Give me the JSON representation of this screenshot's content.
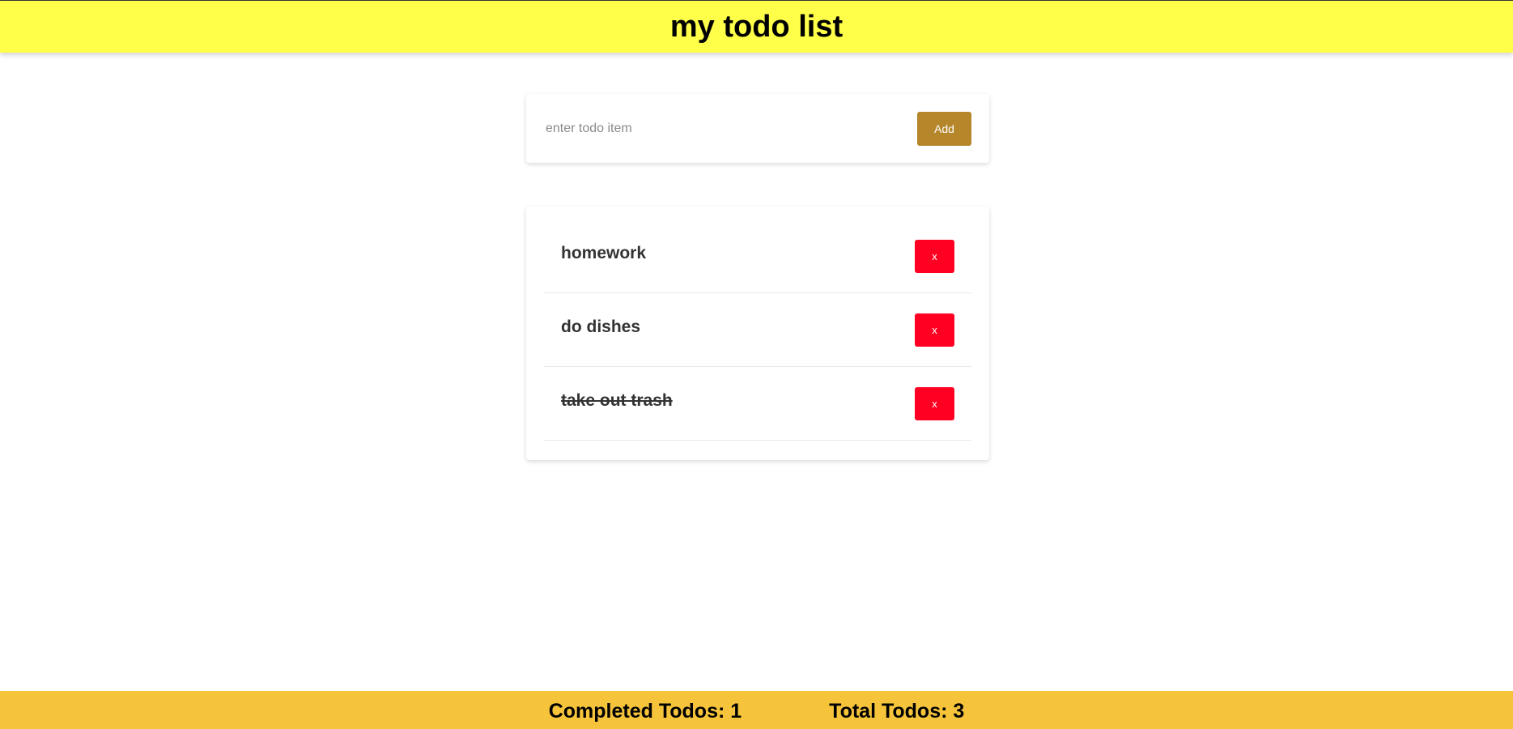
{
  "header": {
    "title": "my todo list"
  },
  "add_form": {
    "input_placeholder": "enter todo item",
    "input_value": "",
    "add_label": "Add"
  },
  "todos": [
    {
      "text": "homework",
      "completed": false,
      "delete_label": "x"
    },
    {
      "text": "do dishes",
      "completed": false,
      "delete_label": "x"
    },
    {
      "text": "take out trash",
      "completed": true,
      "delete_label": "x"
    }
  ],
  "footer": {
    "completed_text": "Completed Todos: 1",
    "total_text": "Total Todos: 3"
  },
  "colors": {
    "header_bg": "#ffff4a",
    "add_button": "#b5862a",
    "delete_button": "#ff0022",
    "footer_bg": "#f5c43b"
  }
}
